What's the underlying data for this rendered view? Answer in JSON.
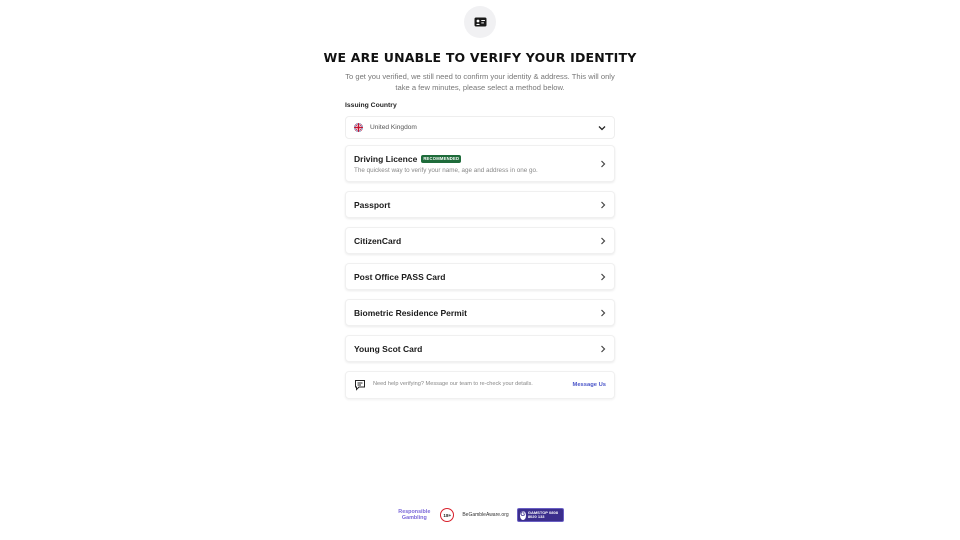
{
  "header": {
    "icon": "id-card-icon",
    "title": "WE ARE UNABLE TO VERIFY YOUR IDENTITY",
    "subtitle": "To get you verified, we still need to confirm your identity & address. This will only take a few minutes, please select a method below."
  },
  "country": {
    "label": "Issuing Country",
    "value": "United Kingdom",
    "flag_icon": "uk-flag-icon"
  },
  "methods": [
    {
      "label": "Driving Licence",
      "badge": "RECOMMENDED",
      "description": "The quickest way to verify your name, age and address in one go."
    },
    {
      "label": "Passport"
    },
    {
      "label": "CitizenCard"
    },
    {
      "label": "Post Office PASS Card"
    },
    {
      "label": "Biometric Residence Permit"
    },
    {
      "label": "Young Scot Card"
    }
  ],
  "help": {
    "text": "Need help verifying? Message our team to re-check your details.",
    "link": "Message Us",
    "icon": "chat-icon"
  },
  "footer": {
    "responsible_gambling": "Responsible Gambling",
    "age_limit": "18+",
    "begambleaware": "BeGambleAware.org",
    "gamstop_letter": "G",
    "gamstop_text": "GAMSTOP 0808 8020 133"
  },
  "colors": {
    "badge": "#1e6b3a",
    "link": "#4b56c9",
    "age_ring": "#d81f2a",
    "gamstop": "#3b2e8c"
  }
}
